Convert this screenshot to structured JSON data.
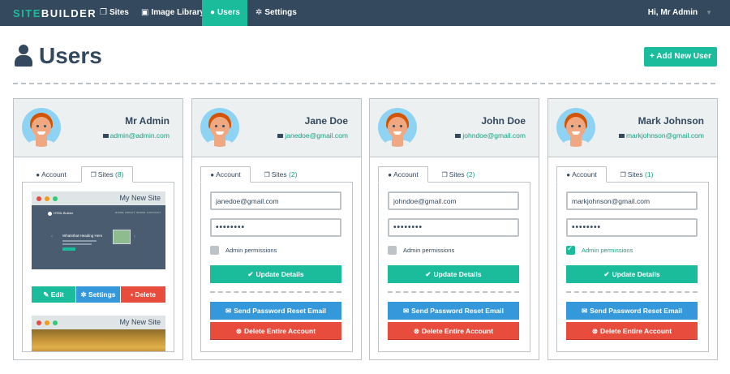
{
  "navbar": {
    "brand_a": "SITE",
    "brand_b": "BUILDER",
    "items": [
      {
        "label": "Sites",
        "icon": "sites-icon"
      },
      {
        "label": "Image Library",
        "icon": "image-icon"
      },
      {
        "label": "Users",
        "icon": "user-icon"
      },
      {
        "label": "Settings",
        "icon": "gear-icon"
      }
    ],
    "user_label": "Hi, Mr Admin"
  },
  "header": {
    "title": "Users",
    "add_button": "Add New User"
  },
  "colors": {
    "navy": "#34495e",
    "teal": "#1abc9c",
    "blue": "#3498db",
    "red": "#e74c3c"
  },
  "users": [
    {
      "name": "Mr Admin",
      "email": "admin@admin.com",
      "tab_account": "Account",
      "tab_sites": "Sites",
      "sites_count": "(8)",
      "sites": [
        {
          "name": "My New Site",
          "preview_logo": "HTML Builder",
          "preview_menu": "HOME  ABOUT  WORK  CONTACT",
          "preview_heading": "Whatsthat Heading Here"
        },
        {
          "name": "My New Site"
        }
      ],
      "site_edit": "Edit",
      "site_settings": "Settings",
      "site_delete": "Delete"
    },
    {
      "name": "Jane Doe",
      "email": "janedoe@gmail.com",
      "tab_account": "Account",
      "tab_sites": "Sites",
      "sites_count": "(2)",
      "email_value": "janedoe@gmail.com",
      "password_value": "••••••••",
      "admin_label": "Admin permissions",
      "admin_checked": false,
      "update_label": "Update Details",
      "reset_label": "Send Password Reset Email",
      "delete_label": "Delete Entire Account"
    },
    {
      "name": "John Doe",
      "email": "johndoe@gmail.com",
      "tab_account": "Account",
      "tab_sites": "Sites",
      "sites_count": "(2)",
      "email_value": "johndoe@gmail.com",
      "password_value": "••••••••",
      "admin_label": "Admin permissions",
      "admin_checked": false,
      "update_label": "Update Details",
      "reset_label": "Send Password Reset Email",
      "delete_label": "Delete Entire Account"
    },
    {
      "name": "Mark Johnson",
      "email": "markjohnson@gmail.com",
      "tab_account": "Account",
      "tab_sites": "Sites",
      "sites_count": "(1)",
      "email_value": "markjohnson@gmail.com",
      "password_value": "••••••••",
      "admin_label": "Admin permissions",
      "admin_checked": true,
      "update_label": "Update Details",
      "reset_label": "Send Password Reset Email",
      "delete_label": "Delete Entire Account"
    }
  ]
}
